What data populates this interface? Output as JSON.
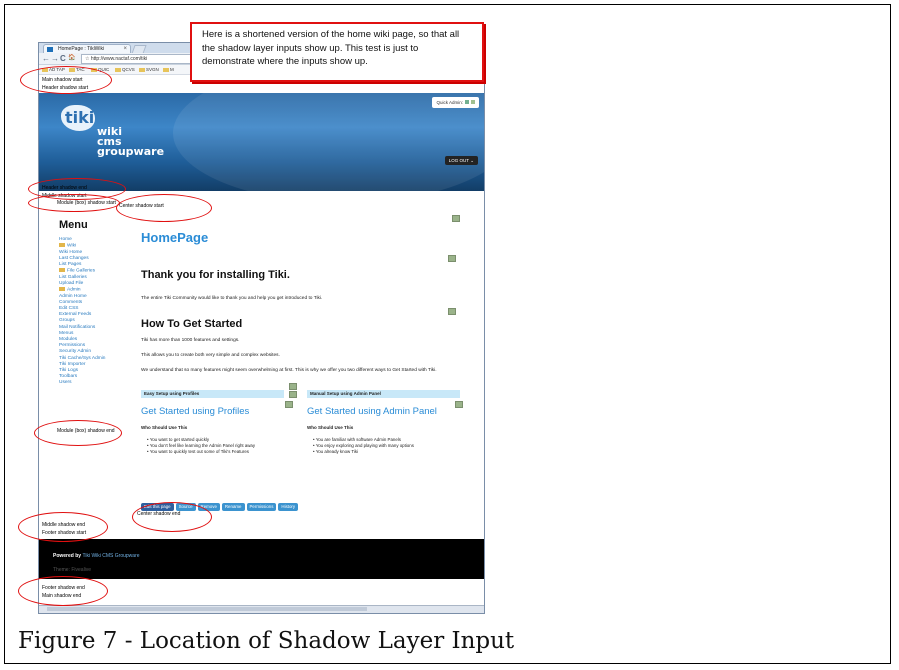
{
  "caption": "Figure 7 - Location of Shadow Layer Input",
  "callout": {
    "text": "Here is a shortened version of the home wiki page, so that all the shadow layer inputs show up.  This test is just to demonstrate where the inputs show up."
  },
  "browser": {
    "tab_title": "HomePage : TikiWiki",
    "tab_close": "×",
    "nav": {
      "back": "←",
      "forward": "→",
      "reload": "C",
      "home": "🏠",
      "star": "☆"
    },
    "url": "http://www.nactaf.com/tiki",
    "bookmarks": [
      "AD TAP",
      "TAC",
      "QUIC",
      "QCVS",
      "SVGN",
      "M"
    ]
  },
  "shadow_labels": {
    "main_start": "Main shadow start",
    "header_start": "Header shadow start",
    "header_end": "Header shadow end",
    "middle_start": "Middle shadow start",
    "module_start": "Module (box) shadow start",
    "center_start": "Center shadow start",
    "module_end": "Module (box) shadow end",
    "center_end": "Center shadow end",
    "middle_end": "Middle shadow end",
    "footer_start": "Footer shadow start",
    "footer_end": "Footer shadow end",
    "main_end": "Main shadow end"
  },
  "header": {
    "logo_mark": "tiki",
    "logo_words": [
      "wiki",
      "cms",
      "groupware"
    ],
    "quick_admin": "Quick Admin:",
    "logout": "LOG OUT"
  },
  "menu": {
    "title": "Menu",
    "items": [
      {
        "label": "Home",
        "folder": false,
        "indent": false
      },
      {
        "label": "Wiki",
        "folder": true,
        "indent": false
      },
      {
        "label": "Wiki Home",
        "folder": false,
        "indent": false
      },
      {
        "label": "Last Changes",
        "folder": false,
        "indent": false
      },
      {
        "label": "List Pages",
        "folder": false,
        "indent": false
      },
      {
        "label": "File Galleries",
        "folder": true,
        "indent": false
      },
      {
        "label": "List Galleries",
        "folder": false,
        "indent": false
      },
      {
        "label": "Upload File",
        "folder": false,
        "indent": false
      },
      {
        "label": "Admin",
        "folder": true,
        "indent": false
      },
      {
        "label": "Admin Home",
        "folder": false,
        "indent": false
      },
      {
        "label": "Comments",
        "folder": false,
        "indent": false
      },
      {
        "label": "Edit CSS",
        "folder": false,
        "indent": false
      },
      {
        "label": "External Feeds",
        "folder": false,
        "indent": false
      },
      {
        "label": "Groups",
        "folder": false,
        "indent": false
      },
      {
        "label": "Mail Notifications",
        "folder": false,
        "indent": false
      },
      {
        "label": "Menus",
        "folder": false,
        "indent": false
      },
      {
        "label": "Modules",
        "folder": false,
        "indent": false
      },
      {
        "label": "Permissions",
        "folder": false,
        "indent": false
      },
      {
        "label": "Security Admin",
        "folder": false,
        "indent": false
      },
      {
        "label": "Tiki Cache/Sys Admin",
        "folder": false,
        "indent": false
      },
      {
        "label": "Tiki Importer",
        "folder": false,
        "indent": false
      },
      {
        "label": "Tiki Logs",
        "folder": false,
        "indent": false
      },
      {
        "label": "Toolbars",
        "folder": false,
        "indent": false
      },
      {
        "label": "Users",
        "folder": false,
        "indent": false
      }
    ]
  },
  "content": {
    "page_title": "HomePage",
    "thanks_heading": "Thank you for installing Tiki.",
    "thanks_text": "The entire Tiki Community would like to thank you and help you get introduced to Tiki.",
    "started_heading": "How To Get Started",
    "p1": "Tiki has more than 1000 features and settings.",
    "p2": "This allows you to create both very simple and complex websites.",
    "p3": "We understand that so many features might seem overwhelming at first. This is why we offer you two different ways to Get Started with Tiki.",
    "left_box": {
      "head": "Easy Setup using Profiles",
      "title": "Get Started using Profiles",
      "who": "Who Should Use This",
      "bullets": [
        "You want to get started quickly",
        "You don't feel like learning the Admin Panel right away",
        "You want to quickly test out some of Tiki's Features"
      ]
    },
    "right_box": {
      "head": "Manual Setup using Admin Panel",
      "title": "Get Started using Admin Panel",
      "who": "Who Should Use This",
      "bullets": [
        "You are familiar with software Admin Panels",
        "You enjoy exploring and playing with many options",
        "You already know Tiki"
      ]
    },
    "buttons": [
      "Edit this page",
      "Source",
      "Remove",
      "Rename",
      "Permissions",
      "History"
    ]
  },
  "footer": {
    "powered_label": "Powered by",
    "powered_link": "Tiki Wiki CMS Groupware",
    "theme": "Theme: Fivealive"
  },
  "colors": {
    "annotation": "#e01010",
    "tiki_blue": "#2a8cd6",
    "header_blue": "#2b6aa6"
  }
}
